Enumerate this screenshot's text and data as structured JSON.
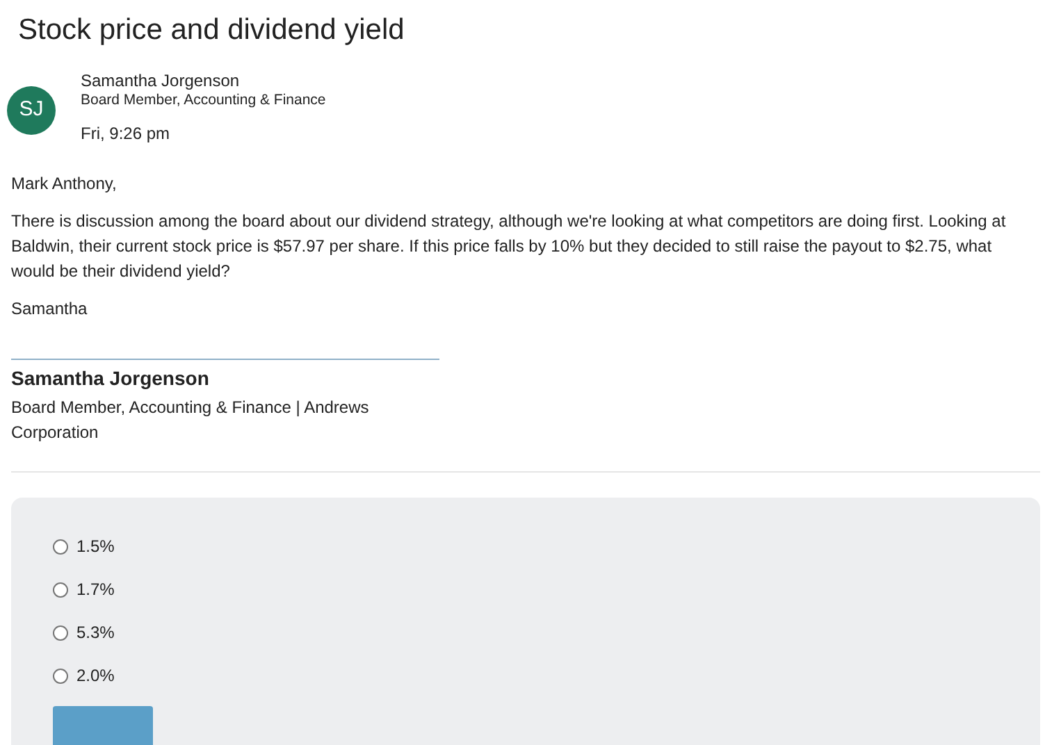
{
  "title": "Stock price and dividend yield",
  "sender": {
    "initials": "SJ",
    "name": "Samantha Jorgenson",
    "role": "Board Member, Accounting & Finance",
    "time": "Fri, 9:26 pm"
  },
  "message": {
    "greeting": "Mark Anthony,",
    "body": "There is discussion among the board about our dividend strategy, although we're looking at what competitors are doing first. Looking at Baldwin, their current stock price is $57.97 per share. If this price falls by 10% but they decided to still raise the payout to $2.75, what would be their dividend yield?",
    "closing": "Samantha"
  },
  "signature": {
    "name": "Samantha Jorgenson",
    "title": "Board Member, Accounting & Finance | Andrews Corporation"
  },
  "options": [
    {
      "label": "1.5%",
      "selected": false
    },
    {
      "label": "1.7%",
      "selected": false
    },
    {
      "label": "5.3%",
      "selected": false
    },
    {
      "label": "2.0%",
      "selected": false
    }
  ]
}
